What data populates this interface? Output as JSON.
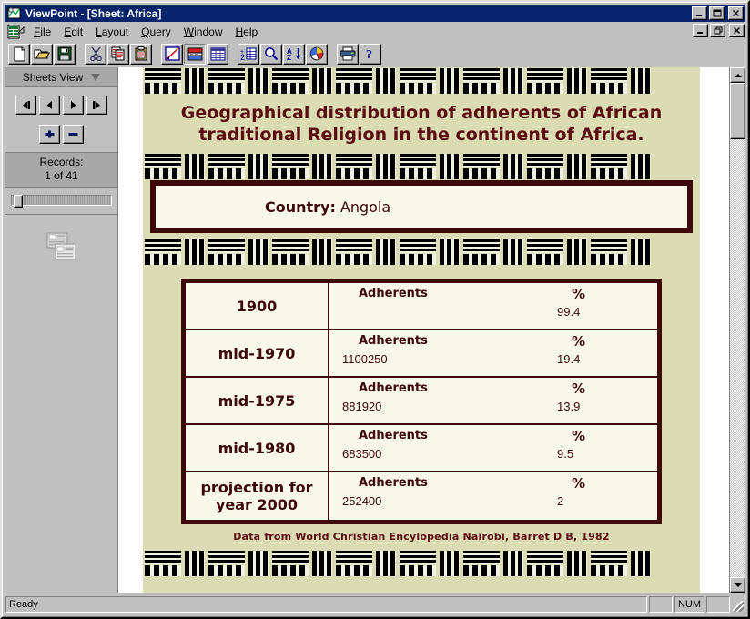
{
  "window": {
    "title": "ViewPoint - [Sheet: Africa]",
    "app_icon": "viewpoint-app-icon",
    "minimize_label": "_",
    "maximize_label": "□",
    "close_label": "✕",
    "child_minimize_label": "_",
    "child_restore_label": "❐",
    "child_close_label": "✕"
  },
  "menu": {
    "doc_icon": "document-sheet-icon",
    "items": [
      {
        "label": "File",
        "accel": "F"
      },
      {
        "label": "Edit",
        "accel": "E"
      },
      {
        "label": "Layout",
        "accel": "L"
      },
      {
        "label": "Query",
        "accel": "Q"
      },
      {
        "label": "Window",
        "accel": "W"
      },
      {
        "label": "Help",
        "accel": "H"
      }
    ]
  },
  "toolbar": {
    "buttons": [
      {
        "name": "new-button",
        "icon": "new-document-icon",
        "pressed": false
      },
      {
        "name": "open-button",
        "icon": "open-folder-icon",
        "pressed": false
      },
      {
        "name": "save-button",
        "icon": "floppy-save-icon",
        "pressed": false
      },
      {
        "name": "cut-button",
        "icon": "scissors-icon",
        "pressed": false
      },
      {
        "name": "copy-button",
        "icon": "copy-icon",
        "pressed": false
      },
      {
        "name": "paste-button",
        "icon": "clipboard-paste-icon",
        "pressed": false
      },
      {
        "name": "design-view-button",
        "icon": "ruler-pencil-icon",
        "pressed": false
      },
      {
        "name": "sheets-view-button",
        "icon": "sheets-view-icon",
        "pressed": true
      },
      {
        "name": "table-view-button",
        "icon": "table-grid-icon",
        "pressed": false
      },
      {
        "name": "calculate-button",
        "icon": "number-table-icon",
        "pressed": false
      },
      {
        "name": "find-button",
        "icon": "magnifier-icon",
        "pressed": false
      },
      {
        "name": "sort-button",
        "icon": "sort-az-icon",
        "pressed": false
      },
      {
        "name": "chart-button",
        "icon": "pie-chart-icon",
        "pressed": false
      },
      {
        "name": "print-button",
        "icon": "printer-icon",
        "pressed": false
      },
      {
        "name": "help-button",
        "icon": "question-mark-icon",
        "pressed": false
      }
    ]
  },
  "sidebar": {
    "header_label": "Sheets View",
    "header_icon": "chevron-down-icon",
    "nav_buttons": [
      {
        "name": "first-record-button",
        "label": "◀▐",
        "icon": "first-record-icon"
      },
      {
        "name": "prev-record-button",
        "label": "◀",
        "icon": "prev-record-icon"
      },
      {
        "name": "next-record-button",
        "label": "▶",
        "icon": "next-record-icon"
      },
      {
        "name": "last-record-button",
        "label": "▌▶",
        "icon": "last-record-icon"
      }
    ],
    "add_button_label": "+",
    "remove_button_label": "–",
    "records_label": "Records:",
    "records_value": "1 of 41",
    "slider_position_percent": 2,
    "sheet_icon": "stacked-sheets-icon"
  },
  "sheet": {
    "title_line1": "Geographical distribution of adherents of African",
    "title_line2": "traditional Religion in the continent of Africa.",
    "country_label": "Country:",
    "country_value": "Angola",
    "adherents_header": "Adherents",
    "percent_header": "%",
    "rows": [
      {
        "year": "1900",
        "year_line2": "",
        "adherents": "",
        "percent": "99.4"
      },
      {
        "year": "mid-1970",
        "year_line2": "",
        "adherents": "1100250",
        "percent": "19.4"
      },
      {
        "year": "mid-1975",
        "year_line2": "",
        "adherents": "881920",
        "percent": "13.9"
      },
      {
        "year": "mid-1980",
        "year_line2": "",
        "adherents": "683500",
        "percent": "9.5"
      },
      {
        "year": "projection for",
        "year_line2": "year 2000",
        "adherents": "252400",
        "percent": "2"
      }
    ],
    "footnote": "Data from World Christian Encylopedia Nairobi, Barret D B, 1982",
    "colors": {
      "background": "#dcdcb4",
      "ink": "#5b0d11",
      "border": "#3d0808",
      "cell": "#f7f7ea"
    }
  },
  "scrollbar": {
    "up_icon": "scroll-up-arrow-icon",
    "down_icon": "scroll-down-arrow-icon"
  },
  "statusbar": {
    "message": "Ready",
    "pane1": "",
    "num_indicator": "NUM",
    "pane3": ""
  }
}
